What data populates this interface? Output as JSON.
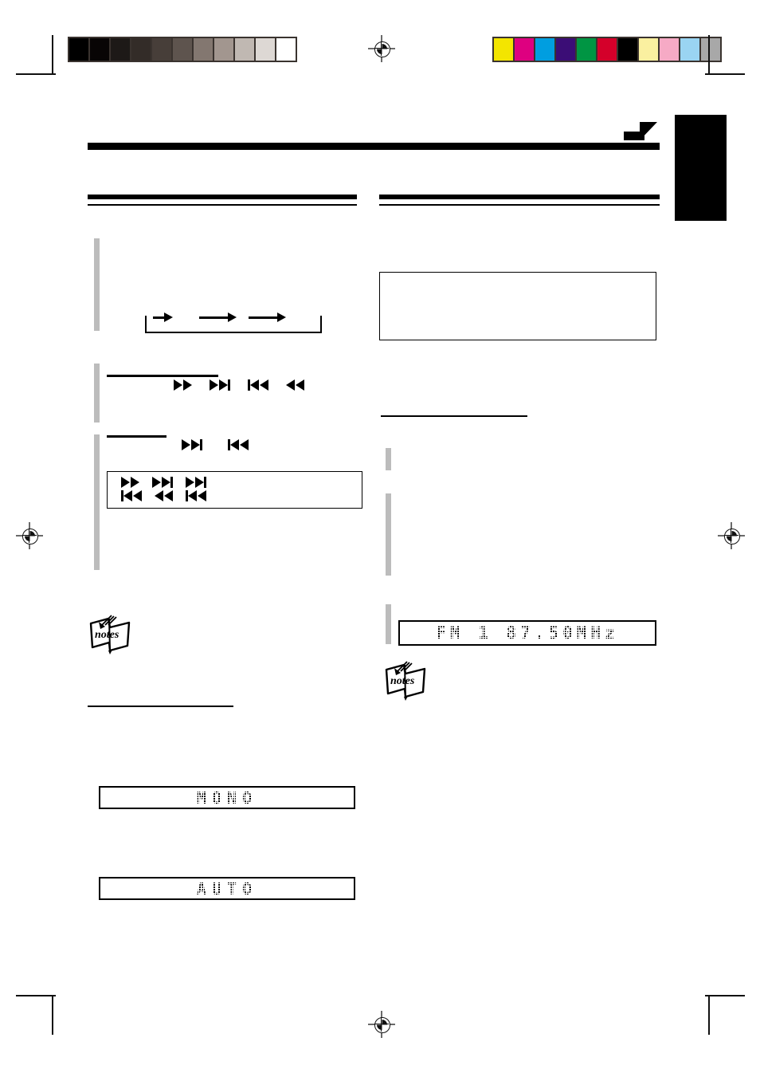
{
  "document": {
    "type": "printed-manual-page-proof",
    "page_background": "#ffffff",
    "ink_color": "#000000",
    "accent_gray": "#bcbcbc"
  },
  "prepress": {
    "grayscale_strip": {
      "label": "grayscale-calibration-strip",
      "swatches": [
        "#000000",
        "#080505",
        "#1d1917",
        "#332c28",
        "#473e39",
        "#5e544e",
        "#837770",
        "#a2968f",
        "#c0b8b2",
        "#ddd8d4",
        "#ffffff"
      ]
    },
    "color_strip": {
      "label": "color-calibration-strip",
      "swatches": [
        "#f3e500",
        "#de0080",
        "#009ee0",
        "#3b0d76",
        "#009543",
        "#d4002a",
        "#000000",
        "#faf0a0",
        "#f6aac5",
        "#9ad4f2",
        "#a8a8a8"
      ]
    },
    "registration_marks": 4,
    "crop_marks": 8
  },
  "header": {
    "page_arrow_icon": "page-turn-arrow-icon",
    "section_tab": "black-section-tab",
    "title_rule": "thick-horizontal-rule"
  },
  "left_column": {
    "heading_rule": "double-rule",
    "cycle_diagram": {
      "name": "playback-mode-cycle-diagram",
      "arrow_count": 3,
      "loop_return": true
    },
    "sub_rule_1": "short-underline",
    "transport_row_1": [
      {
        "icon": "fast-forward-icon",
        "glyph": "fast-forward"
      },
      {
        "icon": "skip-next-icon",
        "glyph": "skip-next"
      },
      {
        "icon": "skip-previous-icon",
        "glyph": "skip-previous"
      },
      {
        "icon": "rewind-icon",
        "glyph": "rewind"
      }
    ],
    "sub_rule_2": "short-underline",
    "transport_row_2": [
      {
        "icon": "skip-next-icon",
        "glyph": "skip-next"
      },
      {
        "icon": "skip-previous-icon",
        "glyph": "skip-previous"
      }
    ],
    "button_box": {
      "name": "transport-button-reference-box",
      "rows": [
        [
          {
            "icon": "fast-forward-icon",
            "glyph": "fast-forward"
          },
          {
            "icon": "skip-next-icon",
            "glyph": "skip-next"
          },
          {
            "icon": "skip-next-icon",
            "glyph": "skip-next"
          }
        ],
        [
          {
            "icon": "skip-previous-icon",
            "glyph": "skip-previous"
          },
          {
            "icon": "rewind-icon",
            "glyph": "rewind"
          },
          {
            "icon": "skip-previous-icon",
            "glyph": "skip-previous"
          }
        ]
      ]
    },
    "notes_icon": "notes-icon",
    "notes_label": "notes",
    "sub_rule_3": "short-underline",
    "display_mono": {
      "name": "lcd-display-mono",
      "text": "MONO"
    },
    "display_auto": {
      "name": "lcd-display-auto",
      "text": "AUTO"
    },
    "step_bars": 3
  },
  "right_column": {
    "heading_rule": "double-rule",
    "callout_box": {
      "name": "empty-callout-box"
    },
    "sub_rule_1": "short-underline",
    "step_bars": 3,
    "display_tuner": {
      "name": "lcd-display-tuner",
      "band": "FM",
      "preset": "1",
      "frequency": "87.50",
      "unit": "MHz",
      "text": "FM  1   87.50MHz"
    },
    "notes_icon": "notes-icon",
    "notes_label": "notes"
  }
}
